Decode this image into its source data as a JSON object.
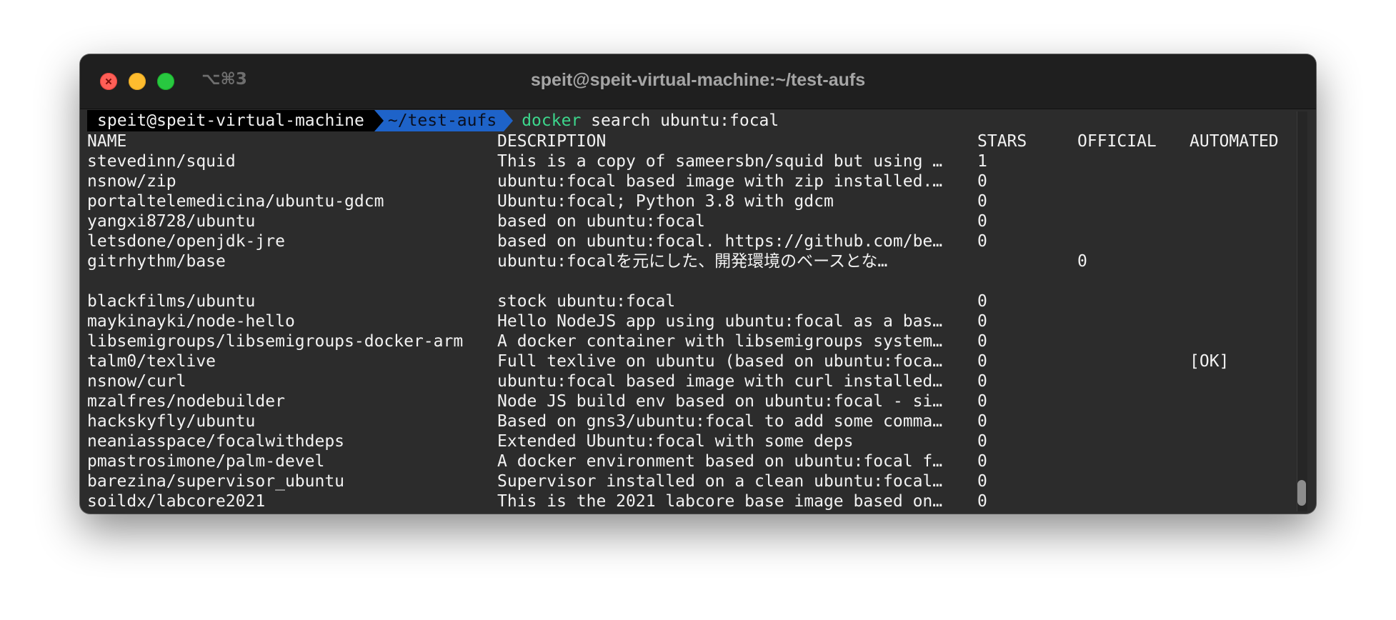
{
  "window": {
    "title": "speit@speit-virtual-machine:~/test-aufs",
    "shortcut": "⌥⌘3"
  },
  "prompt": {
    "user_host": "speit@speit-virtual-machine",
    "directory": "~/test-aufs",
    "command_name": "docker",
    "command_args": "search ubuntu:focal"
  },
  "table": {
    "headers": {
      "name": "NAME",
      "description": "DESCRIPTION",
      "stars": "STARS",
      "official": "OFFICIAL",
      "automated": "AUTOMATED"
    },
    "rows": [
      {
        "name": "stevedinn/squid",
        "description": "This is a copy of sameersbn/squid but using …",
        "stars": "1",
        "official": "",
        "automated": ""
      },
      {
        "name": "nsnow/zip",
        "description": "ubuntu:focal based image with zip installed.…",
        "stars": "0",
        "official": "",
        "automated": ""
      },
      {
        "name": "portaltelemedicina/ubuntu-gdcm",
        "description": "Ubuntu:focal; Python 3.8 with gdcm",
        "stars": "0",
        "official": "",
        "automated": ""
      },
      {
        "name": "yangxi8728/ubuntu",
        "description": "based on ubuntu:focal",
        "stars": "0",
        "official": "",
        "automated": ""
      },
      {
        "name": "letsdone/openjdk-jre",
        "description": "based on ubuntu:focal. https://github.com/be…",
        "stars": "0",
        "official": "",
        "automated": ""
      },
      {
        "name": "gitrhythm/base",
        "description": "ubuntu:focalを元にした、開発環境のベースとな…",
        "stars": "",
        "official": "0",
        "automated": ""
      },
      {
        "name": "",
        "description": "",
        "stars": "",
        "official": "",
        "automated": ""
      },
      {
        "name": "blackfilms/ubuntu",
        "description": "stock ubuntu:focal",
        "stars": "0",
        "official": "",
        "automated": ""
      },
      {
        "name": "maykinayki/node-hello",
        "description": "Hello NodeJS app using ubuntu:focal as a bas…",
        "stars": "0",
        "official": "",
        "automated": ""
      },
      {
        "name": "libsemigroups/libsemigroups-docker-arm",
        "description": "A docker container with libsemigroups system…",
        "stars": "0",
        "official": "",
        "automated": ""
      },
      {
        "name": "talm0/texlive",
        "description": "Full texlive on ubuntu (based on ubuntu:foca…",
        "stars": "0",
        "official": "",
        "automated": "[OK]"
      },
      {
        "name": "nsnow/curl",
        "description": "ubuntu:focal based image with curl installed…",
        "stars": "0",
        "official": "",
        "automated": ""
      },
      {
        "name": "mzalfres/nodebuilder",
        "description": "Node JS build env based on ubuntu:focal - si…",
        "stars": "0",
        "official": "",
        "automated": ""
      },
      {
        "name": "hackskyfly/ubuntu",
        "description": "Based on gns3/ubuntu:focal to add some comma…",
        "stars": "0",
        "official": "",
        "automated": ""
      },
      {
        "name": "neaniasspace/focalwithdeps",
        "description": "Extended Ubuntu:focal with some deps",
        "stars": "0",
        "official": "",
        "automated": ""
      },
      {
        "name": "pmastrosimone/palm-devel",
        "description": "A docker environment based on ubuntu:focal f…",
        "stars": "0",
        "official": "",
        "automated": ""
      },
      {
        "name": "barezina/supervisor_ubuntu",
        "description": "Supervisor installed on a clean ubuntu:focal…",
        "stars": "0",
        "official": "",
        "automated": ""
      },
      {
        "name": "soildx/labcore2021",
        "description": "This is the 2021 labcore base image based on…",
        "stars": "0",
        "official": "",
        "automated": ""
      }
    ]
  }
}
